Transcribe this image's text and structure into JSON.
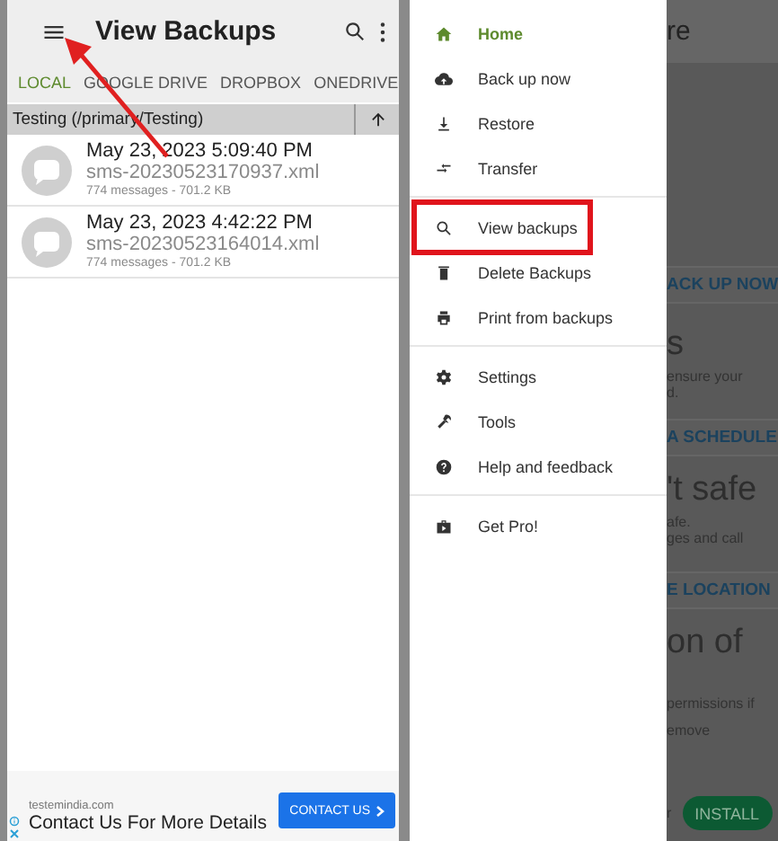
{
  "backups_screen": {
    "title": "View Backups",
    "tabs": [
      {
        "label": "LOCAL",
        "selected": true
      },
      {
        "label": "GOOGLE DRIVE",
        "selected": false
      },
      {
        "label": "DROPBOX",
        "selected": false
      },
      {
        "label": "ONEDRIVE",
        "selected": false
      }
    ],
    "folder": "Testing (/primary/Testing)",
    "backups": [
      {
        "date": "May 23, 2023 5:09:40 PM",
        "file": "sms-20230523170937.xml",
        "details": "774 messages - 701.2 KB"
      },
      {
        "date": "May 23, 2023 4:42:22 PM",
        "file": "sms-20230523164014.xml",
        "details": "774 messages - 701.2 KB"
      }
    ],
    "ad": {
      "domain": "testemindia.com",
      "headline": "Contact Us For More Details",
      "button": "CONTACT US"
    }
  },
  "drawer": {
    "groups": [
      [
        {
          "label": "Home",
          "selected": true,
          "highlighted": false
        },
        {
          "label": "Back up now",
          "selected": false,
          "highlighted": false
        },
        {
          "label": "Restore",
          "selected": false,
          "highlighted": false
        },
        {
          "label": "Transfer",
          "selected": false,
          "highlighted": false
        }
      ],
      [
        {
          "label": "View backups",
          "selected": false,
          "highlighted": true
        },
        {
          "label": "Delete Backups",
          "selected": false,
          "highlighted": false
        },
        {
          "label": "Print from backups",
          "selected": false,
          "highlighted": false
        }
      ],
      [
        {
          "label": "Settings",
          "selected": false,
          "highlighted": false
        },
        {
          "label": "Tools",
          "selected": false,
          "highlighted": false
        },
        {
          "label": "Help and feedback",
          "selected": false,
          "highlighted": false
        }
      ],
      [
        {
          "label": "Get Pro!",
          "selected": false,
          "highlighted": false
        }
      ]
    ]
  },
  "background_screen": {
    "title": "re",
    "texts": [
      {
        "kind": "action",
        "text": "ACK UP NOW"
      },
      {
        "kind": "heading",
        "text": "s"
      },
      {
        "kind": "body",
        "text": "ensure your"
      },
      {
        "kind": "body",
        "text": "d."
      },
      {
        "kind": "action",
        "text": "A SCHEDULE"
      },
      {
        "kind": "heading",
        "text": "'t safe"
      },
      {
        "kind": "body",
        "text": "afe."
      },
      {
        "kind": "body",
        "text": "ges and call"
      },
      {
        "kind": "action",
        "text": "E LOCATION"
      },
      {
        "kind": "heading",
        "text": "on of"
      },
      {
        "kind": "body",
        "text": "permissions if"
      },
      {
        "kind": "body",
        "text": "emove"
      }
    ],
    "footer": {
      "text": "r",
      "button": "INSTALL"
    }
  },
  "annotations": [
    {
      "kind": "arrow"
    }
  ]
}
